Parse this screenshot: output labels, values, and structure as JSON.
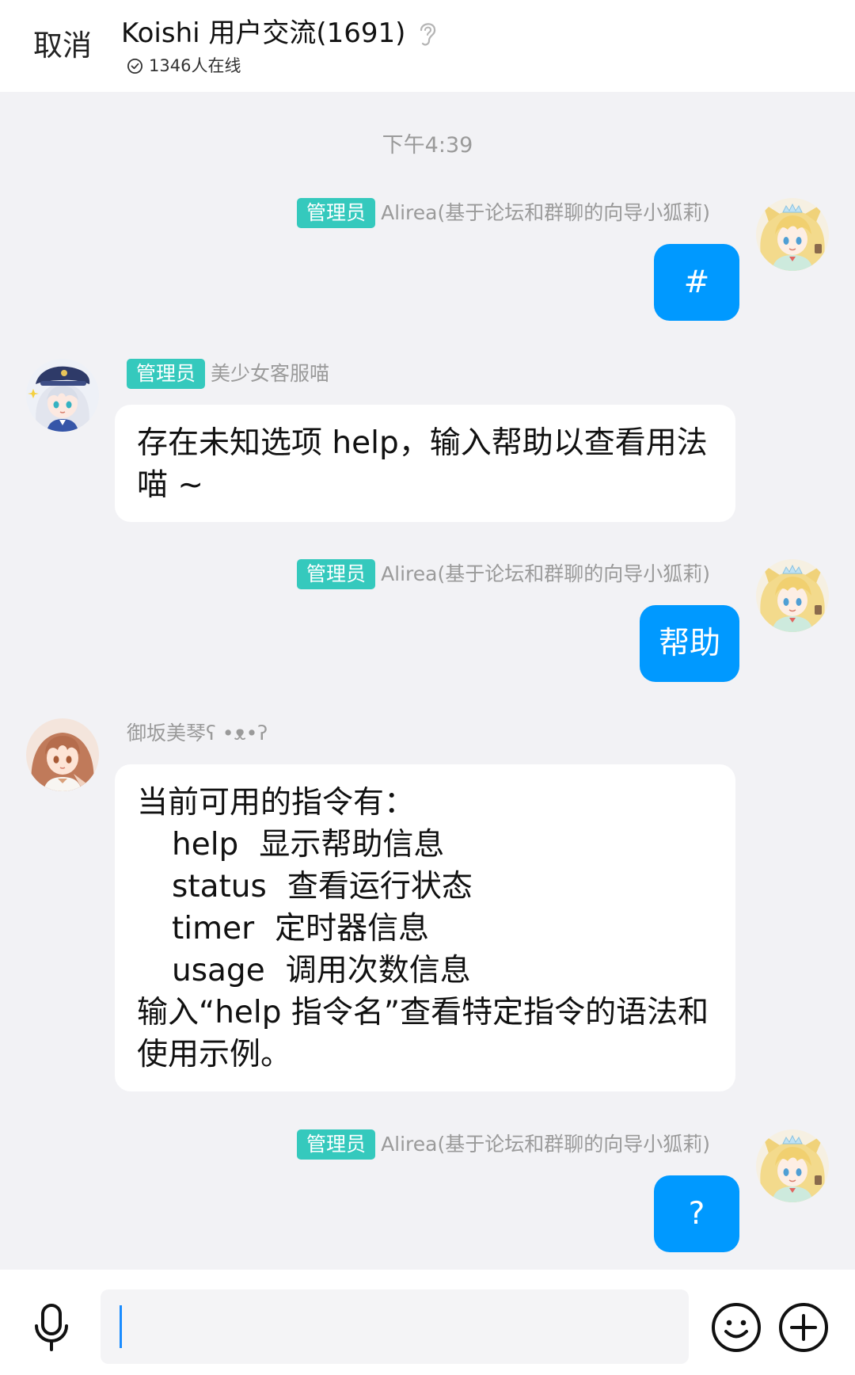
{
  "header": {
    "cancel_label": "取消",
    "title": "Koishi 用户交流(1691)",
    "online_text": "1346人在线"
  },
  "timestamp": "下午4:39",
  "messages": [
    {
      "avatar": "alirea-avatar",
      "badge": "管理员",
      "sender": "Alirea(基于论坛和群聊的向导小狐莉)",
      "text": "#"
    },
    {
      "avatar": "kefu-avatar",
      "badge": "管理员",
      "sender": "美少女客服喵",
      "text": "存在未知选项 help，输入帮助以查看用法喵 ~"
    },
    {
      "avatar": "alirea-avatar",
      "badge": "管理员",
      "sender": "Alirea(基于论坛和群聊的向导小狐莉)",
      "text": "帮助"
    },
    {
      "avatar": "misaka-avatar",
      "sender": "御坂美琴ʕ •ᴥ•ʔ",
      "intro": "当前可用的指令有：",
      "commands": [
        {
          "name": "help",
          "desc": "显示帮助信息"
        },
        {
          "name": "status",
          "desc": "查看运行状态"
        },
        {
          "name": "timer",
          "desc": "定时器信息"
        },
        {
          "name": "usage",
          "desc": "调用次数信息"
        }
      ],
      "footer": "输入“help 指令名”查看特定指令的语法和使用示例。"
    },
    {
      "avatar": "alirea-avatar",
      "badge": "管理员",
      "sender": "Alirea(基于论坛和群聊的向导小狐莉)",
      "text": "?"
    }
  ],
  "input": {
    "value": ""
  },
  "icons": {
    "online": "check-circle-icon",
    "listen": "ear-icon",
    "voice": "microphone-icon",
    "emoji": "smiley-icon",
    "more": "plus-circle-icon"
  },
  "colors": {
    "bubble_self": "#0099ff",
    "bubble_other": "#ffffff",
    "admin_badge": "#35c9bd",
    "chat_background": "#f2f2f5",
    "caret": "#1a8cff"
  }
}
